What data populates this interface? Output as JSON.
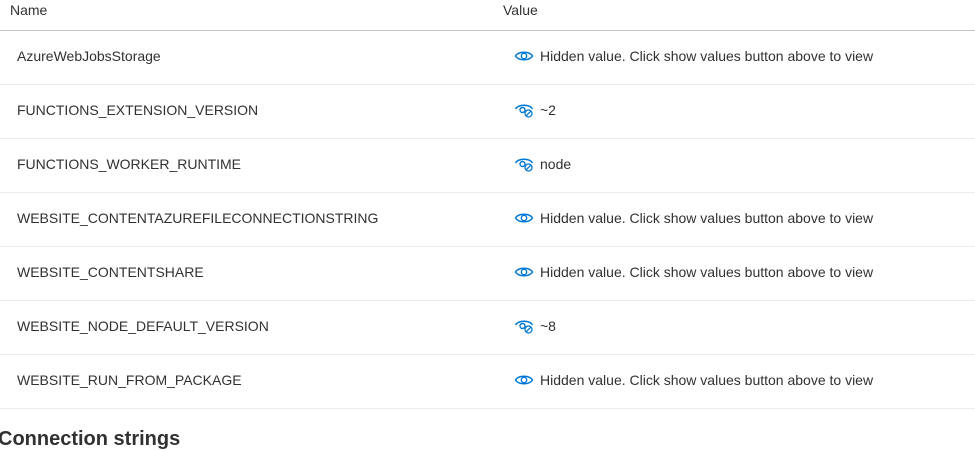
{
  "columns": {
    "name": "Name",
    "value": "Value"
  },
  "settings": [
    {
      "name": "AzureWebJobsStorage",
      "value": "Hidden value. Click show values button above to view",
      "icon": "eye-icon"
    },
    {
      "name": "FUNCTIONS_EXTENSION_VERSION",
      "value": "~2",
      "icon": "eye-hide-icon"
    },
    {
      "name": "FUNCTIONS_WORKER_RUNTIME",
      "value": "node",
      "icon": "eye-hide-icon"
    },
    {
      "name": "WEBSITE_CONTENTAZUREFILECONNECTIONSTRING",
      "value": "Hidden value. Click show values button above to view",
      "icon": "eye-icon"
    },
    {
      "name": "WEBSITE_CONTENTSHARE",
      "value": "Hidden value. Click show values button above to view",
      "icon": "eye-icon"
    },
    {
      "name": "WEBSITE_NODE_DEFAULT_VERSION",
      "value": "~8",
      "icon": "eye-hide-icon"
    },
    {
      "name": "WEBSITE_RUN_FROM_PACKAGE",
      "value": "Hidden value. Click show values button above to view",
      "icon": "eye-icon"
    }
  ],
  "section": {
    "title": "Connection strings"
  },
  "colors": {
    "icon": "#0078d4",
    "text": "#323130",
    "divider": "#edebe9"
  }
}
